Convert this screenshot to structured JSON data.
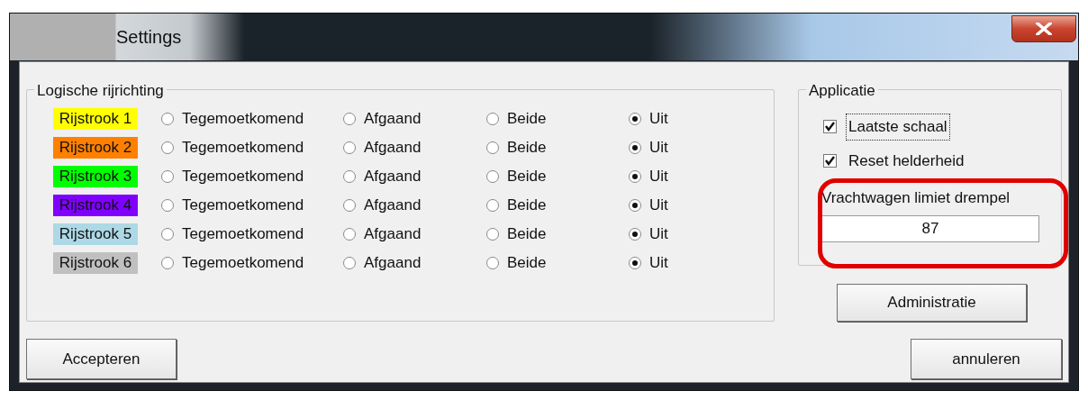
{
  "window": {
    "title": "Settings"
  },
  "direction_group": {
    "title": "Logische rijrichting",
    "lanes": [
      {
        "label": "Rijstrook 1",
        "color": "#ffff00",
        "options": [
          {
            "label": "Tegemoetkomend",
            "selected": false
          },
          {
            "label": "Afgaand",
            "selected": false
          },
          {
            "label": "Beide",
            "selected": false
          },
          {
            "label": "Uit",
            "selected": true
          }
        ]
      },
      {
        "label": "Rijstrook 2",
        "color": "#ff8000",
        "options": [
          {
            "label": "Tegemoetkomend",
            "selected": false
          },
          {
            "label": "Afgaand",
            "selected": false
          },
          {
            "label": "Beide",
            "selected": false
          },
          {
            "label": "Uit",
            "selected": true
          }
        ]
      },
      {
        "label": "Rijstrook 3",
        "color": "#00ff00",
        "options": [
          {
            "label": "Tegemoetkomend",
            "selected": false
          },
          {
            "label": "Afgaand",
            "selected": false
          },
          {
            "label": "Beide",
            "selected": false
          },
          {
            "label": "Uit",
            "selected": true
          }
        ]
      },
      {
        "label": "Rijstrook 4",
        "color": "#8000ff",
        "options": [
          {
            "label": "Tegemoetkomend",
            "selected": false
          },
          {
            "label": "Afgaand",
            "selected": false
          },
          {
            "label": "Beide",
            "selected": false
          },
          {
            "label": "Uit",
            "selected": true
          }
        ]
      },
      {
        "label": "Rijstrook 5",
        "color": "#add8e6",
        "options": [
          {
            "label": "Tegemoetkomend",
            "selected": false
          },
          {
            "label": "Afgaand",
            "selected": false
          },
          {
            "label": "Beide",
            "selected": false
          },
          {
            "label": "Uit",
            "selected": true
          }
        ]
      },
      {
        "label": "Rijstrook 6",
        "color": "#c0c0c0",
        "options": [
          {
            "label": "Tegemoetkomend",
            "selected": false
          },
          {
            "label": "Afgaand",
            "selected": false
          },
          {
            "label": "Beide",
            "selected": false
          },
          {
            "label": "Uit",
            "selected": true
          }
        ]
      }
    ]
  },
  "application_group": {
    "title": "Applicatie",
    "checkboxes": [
      {
        "label": "Laatste schaal",
        "checked": true,
        "focused": true
      },
      {
        "label": "Reset helderheid",
        "checked": true,
        "focused": false
      }
    ],
    "threshold": {
      "label": "Vrachtwagen limiet drempel",
      "value": "87"
    }
  },
  "buttons": {
    "admin": "Administratie",
    "accept": "Accepteren",
    "cancel": "annuleren"
  }
}
